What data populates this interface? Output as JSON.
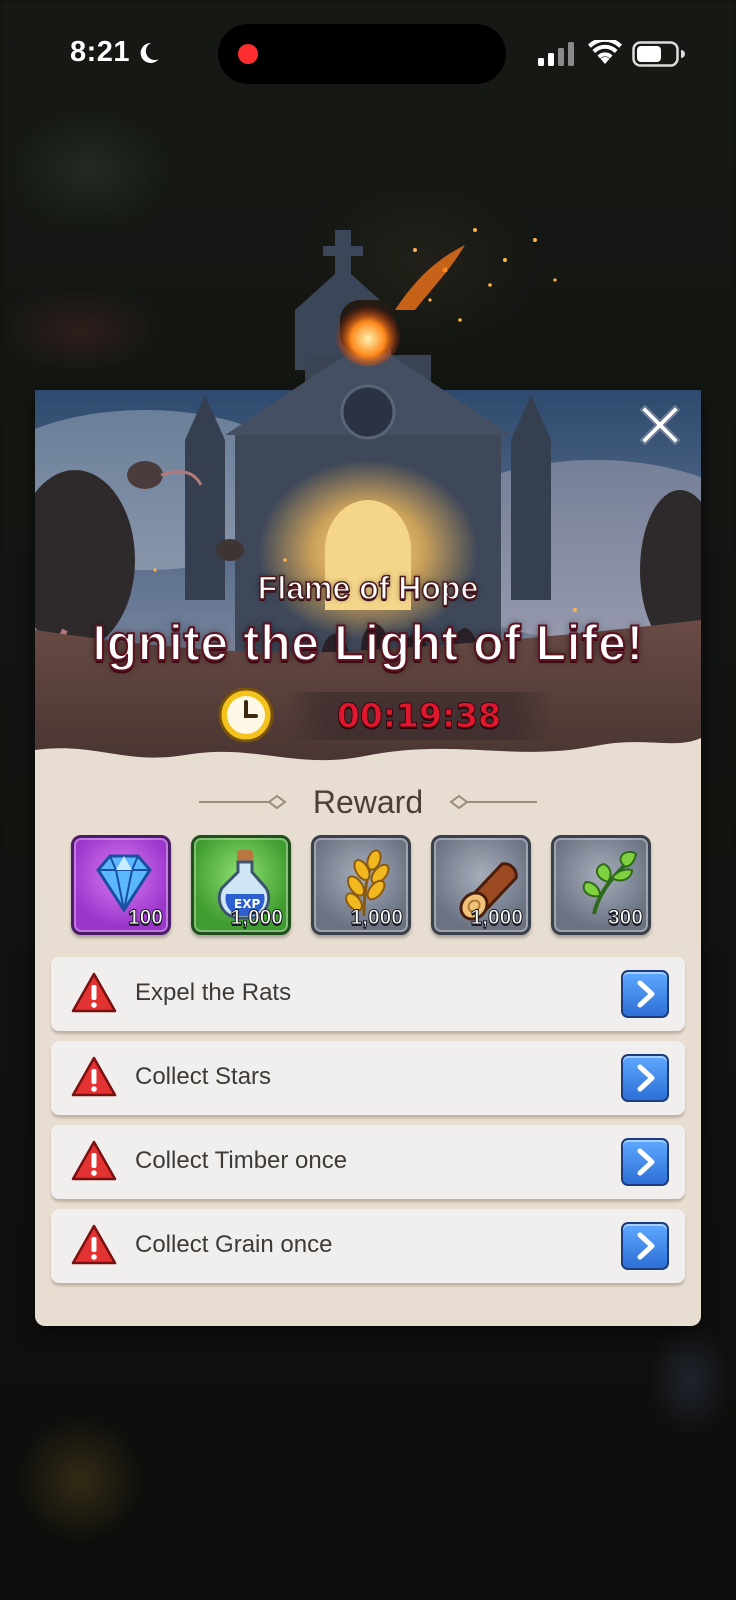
{
  "status_bar": {
    "time": "8:21",
    "icons": [
      "moon-icon",
      "recording-dot",
      "signal-icon",
      "wifi-icon",
      "battery-icon"
    ]
  },
  "event": {
    "subtitle": "Flame of Hope",
    "headline": "Ignite the Light of Life!",
    "timer": "00:19:38",
    "close_icon": "close-icon"
  },
  "rewards": {
    "title": "Reward",
    "items": [
      {
        "icon": "diamond-icon",
        "amount": "100",
        "rarity": "purple"
      },
      {
        "icon": "exp-potion-icon",
        "amount": "1,000",
        "rarity": "green"
      },
      {
        "icon": "grain-icon",
        "amount": "1,000",
        "rarity": "gray"
      },
      {
        "icon": "timber-log-icon",
        "amount": "1,000",
        "rarity": "gray"
      },
      {
        "icon": "herb-icon",
        "amount": "300",
        "rarity": "gray"
      }
    ]
  },
  "tasks": [
    {
      "label": "Expel the Rats",
      "status_icon": "warning-icon",
      "action_icon": "go-arrow-icon"
    },
    {
      "label": "Collect Stars",
      "status_icon": "warning-icon",
      "action_icon": "go-arrow-icon"
    },
    {
      "label": "Collect Timber once",
      "status_icon": "warning-icon",
      "action_icon": "go-arrow-icon"
    },
    {
      "label": "Collect Grain once",
      "status_icon": "warning-icon",
      "action_icon": "go-arrow-icon"
    }
  ],
  "colors": {
    "timer_red": "#e0172e",
    "go_button_blue": "#2d6fd6",
    "panel_bg": "#e7ddd0",
    "purple_rarity": "#9b35cc",
    "green_rarity": "#3f9c2f"
  }
}
